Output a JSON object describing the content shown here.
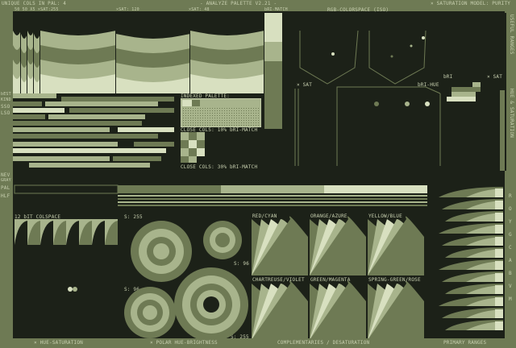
{
  "colors": {
    "dark": "#1c2118",
    "mid": "#6e7a54",
    "light": "#a8b48c",
    "pale": "#d8e0c0"
  },
  "header": {
    "unique_cols": "UNIQUE COLS IN PAL: 4",
    "title": "- ANALYZE PALETTE V2.21 -",
    "saturation_model": "× SATURATION MODEL: PURITY"
  },
  "subheader": {
    "stats": "50 50 X5  ×SAT:255",
    "sat_120": "×SAT: 120",
    "sat_48": "×SAT: 48",
    "bri_match": "bRI-MATCH",
    "rgb_colorspace": "RGB-COLORSPACE (ISO)"
  },
  "left_labels": {
    "best": "bEST",
    "kind": "KIND",
    "sso": "SSO",
    "lso": "LSO",
    "nev": "NEV",
    "gray": "GRAY",
    "pal": "PAL",
    "hlf": "HLF"
  },
  "right_sidebar": {
    "top": "USEFUL RANGES",
    "mid": "HUE & SATURATION",
    "letters": [
      "R",
      "O",
      "Y",
      "G",
      "C",
      "A",
      "B",
      "V",
      "M"
    ]
  },
  "panels": {
    "indexed_palette": "INDEXED PALETTE:",
    "close_cols_10": "CLOSE COLS: 10% bRI-MATCH",
    "close_cols_30": "CLOSE COLS: 30% bRI-MATCH",
    "x_sat_left": "× SAT",
    "bri_hue": "bRI-HUE",
    "x_sat_right": "× SAT",
    "bri_right": "bRI",
    "colspace_12bit": "12 bIT COLSPACE",
    "s_255_a": "S: 255",
    "s_96_a": "S: 96",
    "s_96_b": "S: 96",
    "s_255_b": "S: 255",
    "red_cyan": "RED/CYAN",
    "orange_azure": "ORANGE/AZURE",
    "yellow_blue": "YELLOW/BLUE",
    "chartreuse_violet": "CHARTREUSE/VIOLET",
    "green_magenta": "GREEN/MAGENTA",
    "spring_rose": "SPRING-GREEN/ROSE"
  },
  "footer": {
    "hue_saturation": "× HUE-SATURATION",
    "polar": "× POLAR HUE-BRIGHTNESS",
    "complementaries": "COMPLEMENTARIES / DESATURATION",
    "primary_ranges": "PRIMARY RANGES"
  }
}
